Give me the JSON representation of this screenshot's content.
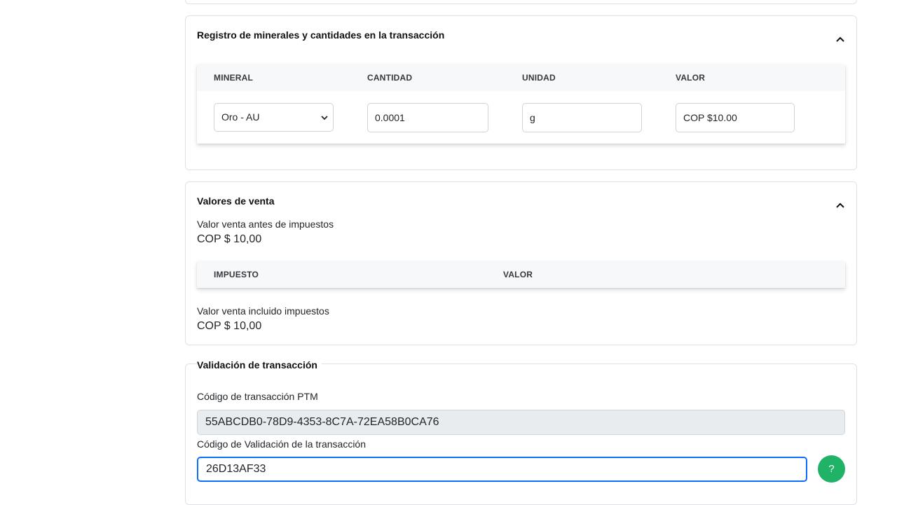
{
  "minerals_section": {
    "title": "Registro de minerales y cantidades en la transacción",
    "columns": [
      "MINERAL",
      "CANTIDAD",
      "UNIDAD",
      "VALOR"
    ],
    "row": {
      "mineral": "Oro - AU",
      "quantity": "0.0001",
      "unit": "g",
      "value": "COP $10.00"
    }
  },
  "sales_section": {
    "title": "Valores de venta",
    "before_tax_label": "Valor venta antes de impuestos",
    "before_tax_value": "COP $ 10,00",
    "columns": [
      "IMPUESTO",
      "VALOR"
    ],
    "after_tax_label": "Valor venta incluido impuestos",
    "after_tax_value": "COP $ 10,00"
  },
  "validation_section": {
    "title": "Validación de transacción",
    "ptm_code_label": "Código de transacción PTM",
    "ptm_code_value": "55ABCDB0-78D9-4353-8C7A-72EA58B0CA76",
    "validation_code_label": "Código de Validación de la transacción",
    "validation_code_value": "26D13AF33",
    "help_label": "?"
  },
  "colors": {
    "accent": "#0d6efd",
    "help_button": "#20b266",
    "border": "#dee2e6",
    "readonly_bg": "#e9ecef"
  },
  "icons": {
    "collapse": "chevron-up-icon",
    "select": "chevron-down-icon"
  }
}
